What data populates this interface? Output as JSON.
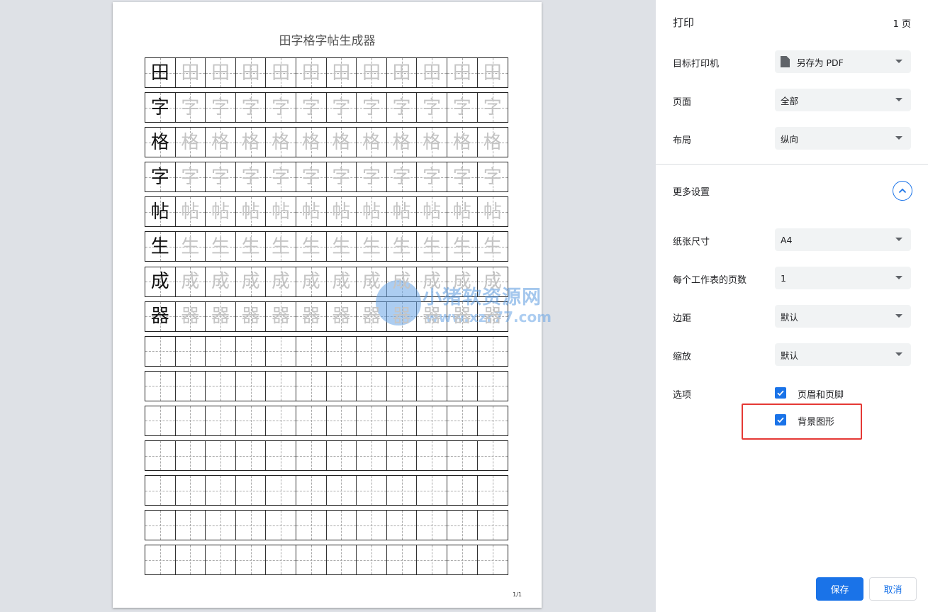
{
  "preview": {
    "doc_title": "田字格字帖生成器",
    "model_chars": [
      "田",
      "字",
      "格",
      "字",
      "帖",
      "生",
      "成",
      "器"
    ],
    "cells_per_row": 12,
    "blank_rows": 7,
    "page_number": "1/1",
    "watermark": {
      "name": "小猪软资源网",
      "url": "www.xzr77.com"
    }
  },
  "panel": {
    "title": "打印",
    "page_count": "1 页",
    "settings": [
      {
        "label": "目标打印机",
        "value": "另存为 PDF",
        "icon": "file-icon"
      },
      {
        "label": "页面",
        "value": "全部"
      },
      {
        "label": "布局",
        "value": "纵向"
      }
    ],
    "more_settings_label": "更多设置",
    "more_settings_icon": "chevron-up-icon",
    "more_settings": [
      {
        "label": "纸张尺寸",
        "value": "A4"
      },
      {
        "label": "每个工作表的页数",
        "value": "1"
      },
      {
        "label": "边距",
        "value": "默认"
      },
      {
        "label": "缩放",
        "value": "默认"
      }
    ],
    "options_label": "选项",
    "options": [
      {
        "label": "页眉和页脚",
        "checked": true
      },
      {
        "label": "背景图形",
        "checked": true
      }
    ],
    "save_label": "保存",
    "cancel_label": "取消",
    "accent_color": "#1a73e8",
    "highlight_color": "#e53935"
  }
}
